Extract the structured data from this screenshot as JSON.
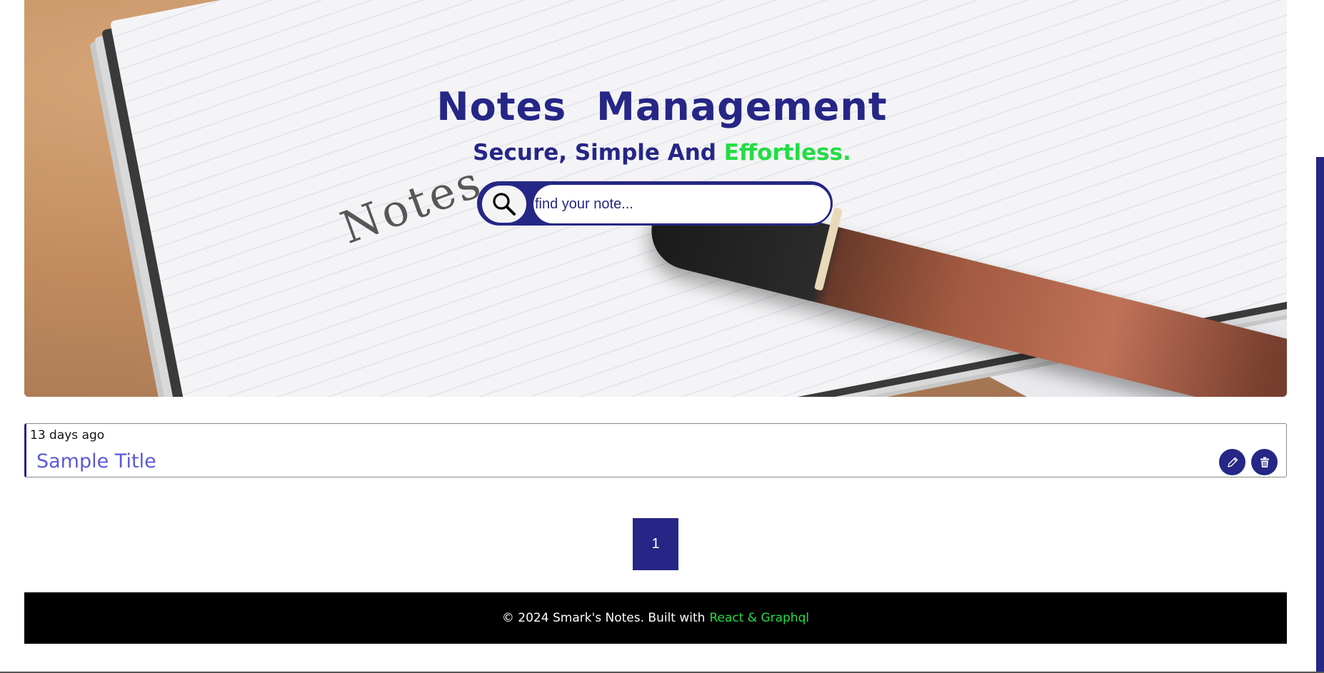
{
  "hero": {
    "title": "Notes Management",
    "subtitle_main": "Secure, Simple And",
    "subtitle_accent": "Effortless.",
    "background_word": "Notes",
    "accent_color": "#22dd44",
    "brand_color": "#262686"
  },
  "search": {
    "placeholder": "find your note...",
    "value": "",
    "icon": "search-icon"
  },
  "notes": [
    {
      "time": "13 days ago",
      "title": "Sample Title",
      "edit_icon": "pencil-icon",
      "delete_icon": "trash-icon"
    }
  ],
  "pagination": {
    "current_page": "1"
  },
  "footer": {
    "text": "© 2024 Smark's Notes. Built with",
    "link": "React & Graphql"
  }
}
